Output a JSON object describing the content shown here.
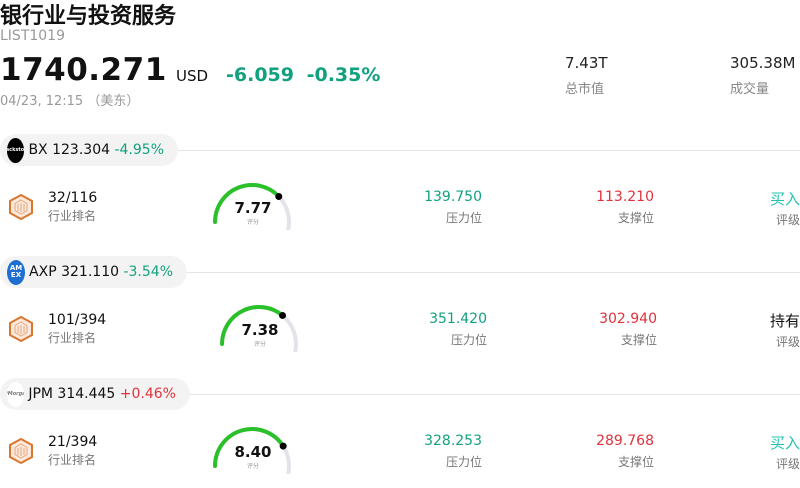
{
  "header": {
    "title": "银行业与投资服务",
    "code": "LIST1019",
    "price": "1740.271",
    "currency": "USD",
    "change": "-6.059",
    "change_pct": "-0.35%",
    "time": "04/23, 12:15 （美东）",
    "market_cap_value": "7.43T",
    "market_cap_label": "总市值",
    "volume_value": "305.38M",
    "volume_label": "成交量",
    "change_color": "#12a17f"
  },
  "labels": {
    "rank": "行业排名",
    "score": "评分",
    "resistance": "压力位",
    "support": "支撑位",
    "rating": "评级"
  },
  "stocks": [
    {
      "logo_icon": "blackstone-logo-icon",
      "logo_text": "Blackstone",
      "symbol": "BX",
      "price": "123.304",
      "change_pct": "-4.95%",
      "rank": "32/116",
      "score": "7.77",
      "score_value": 7.77,
      "resistance": "139.750",
      "support": "113.210",
      "rating": "买入"
    },
    {
      "logo_icon": "amex-logo-icon",
      "logo_text": "AM EX",
      "symbol": "AXP",
      "price": "321.110",
      "change_pct": "-3.54%",
      "rank": "101/394",
      "score": "7.38",
      "score_value": 7.38,
      "resistance": "351.420",
      "support": "302.940",
      "rating": "持有"
    },
    {
      "logo_icon": "jpmorgan-logo-icon",
      "logo_text": "JPMorgan",
      "symbol": "JPM",
      "price": "314.445",
      "change_pct": "+0.46%",
      "rank": "21/394",
      "score": "8.40",
      "score_value": 8.4,
      "resistance": "328.253",
      "support": "289.768",
      "rating": "买入"
    }
  ]
}
